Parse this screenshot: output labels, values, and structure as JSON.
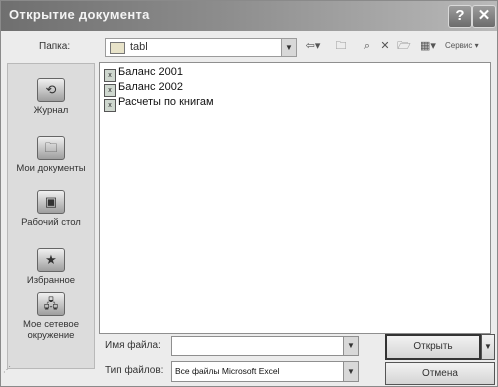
{
  "window": {
    "title": "Открытие документа",
    "help_glyph": "?",
    "close_glyph": "✕"
  },
  "toolbar": {
    "folder_label": "Папка:",
    "folder_value": "tabl",
    "back_glyph": "⇦▾",
    "up_glyph": "🗀",
    "search_glyph": "⌕",
    "delete_glyph": "✕",
    "new_folder_glyph": "🗁",
    "views_glyph": "▦▾",
    "tools_label": "Сервис ▾"
  },
  "places": [
    {
      "label": "Журнал",
      "icon": "history-icon",
      "glyph": "⟲"
    },
    {
      "label": "Мои документы",
      "icon": "my-documents-icon",
      "glyph": "🗀"
    },
    {
      "label": "Рабочий стол",
      "icon": "desktop-icon",
      "glyph": "▣"
    },
    {
      "label": "Избранное",
      "icon": "favorites-icon",
      "glyph": "★"
    },
    {
      "label": "Мое сетевое окружение",
      "icon": "network-icon",
      "glyph": "🖧"
    }
  ],
  "files": [
    {
      "name": "Баланс 2001"
    },
    {
      "name": "Баланс 2002"
    },
    {
      "name": "Расчеты по книгам"
    }
  ],
  "bottom": {
    "filename_label": "Имя файла:",
    "filename_value": "",
    "filetype_label": "Тип файлов:",
    "filetype_value": "Все файлы Microsoft Excel",
    "open_label": "Открыть",
    "cancel_label": "Отмена",
    "dropdown_glyph": "▼"
  }
}
